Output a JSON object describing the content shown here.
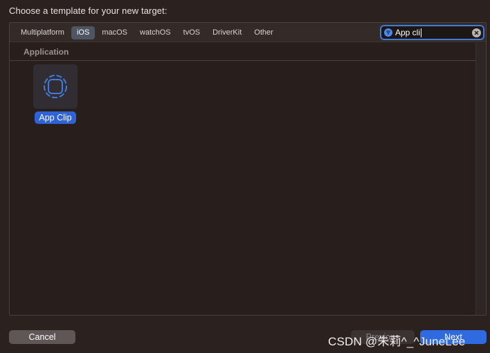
{
  "dialog": {
    "prompt": "Choose a template for your new target:"
  },
  "platform_tabs": [
    {
      "label": "Multiplatform",
      "active": false
    },
    {
      "label": "iOS",
      "active": true
    },
    {
      "label": "macOS",
      "active": false
    },
    {
      "label": "watchOS",
      "active": false
    },
    {
      "label": "tvOS",
      "active": false
    },
    {
      "label": "DriverKit",
      "active": false
    },
    {
      "label": "Other",
      "active": false
    }
  ],
  "search": {
    "value": "App cli",
    "icon": "filter-icon",
    "clear_icon": "clear-icon"
  },
  "section": {
    "title": "Application"
  },
  "templates": [
    {
      "label": "App Clip",
      "icon": "app-clip-icon",
      "selected": true
    }
  ],
  "buttons": {
    "cancel": "Cancel",
    "previous": "Previous",
    "next": "Next"
  },
  "watermark": "CSDN @朱莉^_^JuneLee",
  "colors": {
    "background": "#2b2220",
    "accent": "#2f6ae0",
    "selected_label": "#2f62d4",
    "active_tab": "#4e5563"
  }
}
